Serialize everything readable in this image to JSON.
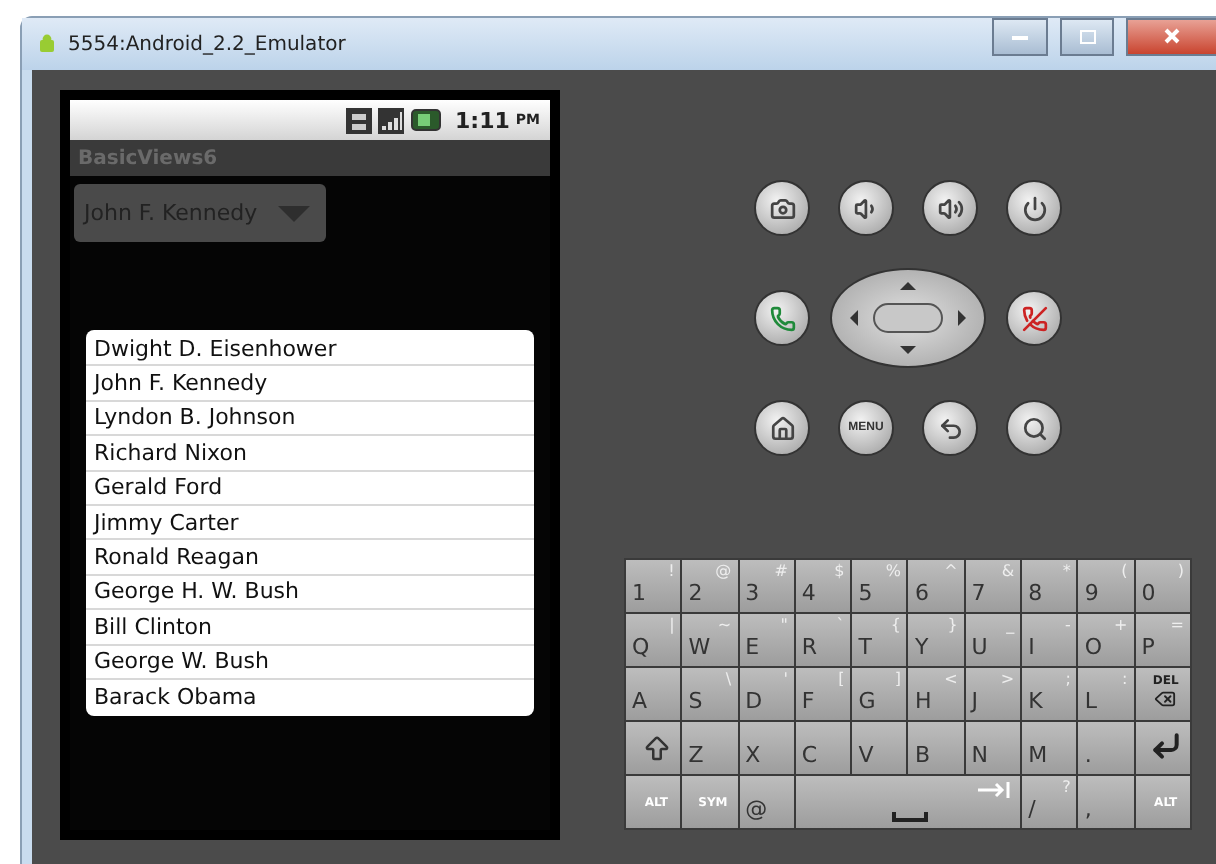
{
  "window": {
    "title": "5554:Android_2.2_Emulator"
  },
  "status_bar": {
    "time": "1:11",
    "ampm": "PM"
  },
  "app_title": "BasicViews6",
  "spinner": {
    "value": "John F. Kennedy"
  },
  "list": [
    "Dwight D. Eisenhower",
    "John F. Kennedy",
    "Lyndon B. Johnson",
    "Richard Nixon",
    "Gerald Ford",
    "Jimmy Carter",
    "Ronald Reagan",
    "George H. W. Bush",
    "Bill Clinton",
    "George W. Bush",
    "Barack Obama"
  ],
  "hardware_keys": [
    {
      "kind": "camera"
    },
    {
      "kind": "volume-down"
    },
    {
      "kind": "volume-up"
    },
    {
      "kind": "power"
    },
    {
      "kind": "call"
    },
    {
      "kind": "dpad"
    },
    {
      "kind": "end-call"
    },
    {
      "kind": "home"
    },
    {
      "kind": "menu",
      "label": "MENU"
    },
    {
      "kind": "back"
    },
    {
      "kind": "search"
    }
  ],
  "keyboard": [
    [
      {
        "kind": "text",
        "label": "1",
        "alt": "!"
      },
      {
        "kind": "text",
        "label": "2",
        "alt": "@"
      },
      {
        "kind": "text",
        "label": "3",
        "alt": "#"
      },
      {
        "kind": "text",
        "label": "4",
        "alt": "$"
      },
      {
        "kind": "text",
        "label": "5",
        "alt": "%"
      },
      {
        "kind": "text",
        "label": "6",
        "alt": "^"
      },
      {
        "kind": "text",
        "label": "7",
        "alt": "&"
      },
      {
        "kind": "text",
        "label": "8",
        "alt": "*"
      },
      {
        "kind": "text",
        "label": "9",
        "alt": "("
      },
      {
        "kind": "text",
        "label": "0",
        "alt": ")"
      }
    ],
    [
      {
        "kind": "text",
        "label": "Q",
        "alt": "|"
      },
      {
        "kind": "text",
        "label": "W",
        "alt": "~"
      },
      {
        "kind": "text",
        "label": "E",
        "alt": "\""
      },
      {
        "kind": "text",
        "label": "R",
        "alt": "`"
      },
      {
        "kind": "text",
        "label": "T",
        "alt": "{"
      },
      {
        "kind": "text",
        "label": "Y",
        "alt": "}"
      },
      {
        "kind": "text",
        "label": "U",
        "alt": "_"
      },
      {
        "kind": "text",
        "label": "I",
        "alt": "-"
      },
      {
        "kind": "text",
        "label": "O",
        "alt": "+"
      },
      {
        "kind": "text",
        "label": "P",
        "alt": "="
      }
    ],
    [
      {
        "kind": "text",
        "label": "A"
      },
      {
        "kind": "text",
        "label": "S",
        "alt": "\\"
      },
      {
        "kind": "text",
        "label": "D",
        "alt": "'"
      },
      {
        "kind": "text",
        "label": "F",
        "alt": "["
      },
      {
        "kind": "text",
        "label": "G",
        "alt": "]"
      },
      {
        "kind": "text",
        "label": "H",
        "alt": "<"
      },
      {
        "kind": "text",
        "label": "J",
        "alt": ">"
      },
      {
        "kind": "text",
        "label": "K",
        "alt": ";"
      },
      {
        "kind": "text",
        "label": "L",
        "alt": ":"
      },
      {
        "kind": "del",
        "label": "DEL"
      }
    ],
    [
      {
        "kind": "shift"
      },
      {
        "kind": "text",
        "label": "Z"
      },
      {
        "kind": "text",
        "label": "X"
      },
      {
        "kind": "text",
        "label": "C"
      },
      {
        "kind": "text",
        "label": "V"
      },
      {
        "kind": "text",
        "label": "B"
      },
      {
        "kind": "text",
        "label": "N"
      },
      {
        "kind": "text",
        "label": "M"
      },
      {
        "kind": "text",
        "label": "."
      },
      {
        "kind": "enter"
      }
    ],
    [
      {
        "kind": "small",
        "label": "ALT"
      },
      {
        "kind": "small",
        "label": "SYM"
      },
      {
        "kind": "text",
        "label": "@"
      },
      {
        "kind": "space"
      },
      {
        "kind": "text",
        "label": "/",
        "alt": "?"
      },
      {
        "kind": "text",
        "label": ","
      },
      {
        "kind": "small",
        "label": "ALT"
      }
    ]
  ]
}
